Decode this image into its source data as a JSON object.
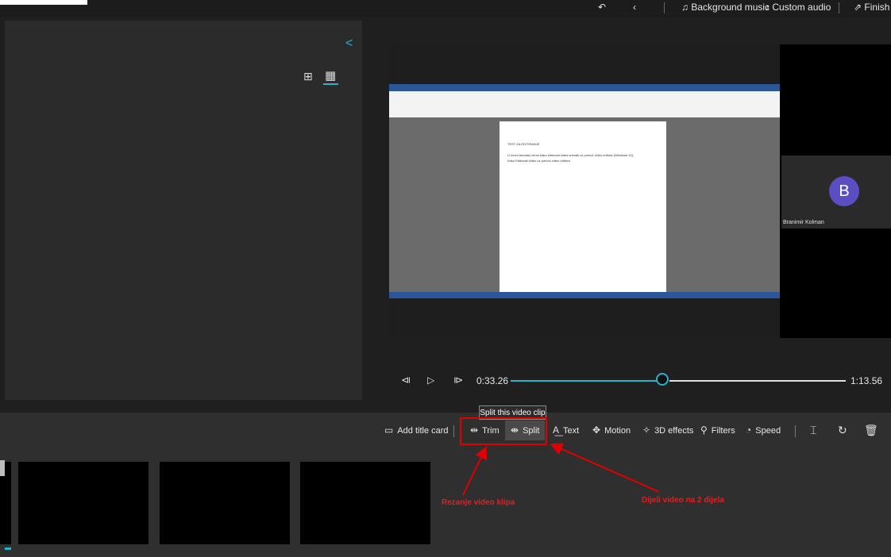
{
  "topbar": {
    "background_music": "Background music",
    "custom_audio": "Custom audio",
    "finish": "Finish v"
  },
  "library": {
    "collapse_icon": "chevron-left-icon",
    "view_options": [
      "grid-large-icon",
      "grid-small-icon"
    ]
  },
  "preview": {
    "doc_lines": [
      "TEST ZA EDITIRANJE",
      "U ovom tutorialu ćemo kako editovati video snimak uz pomoć video editora (Windows 10).",
      "Kako Editovati video uz pomoć video editora"
    ],
    "participant": {
      "initial": "B",
      "name": "Branimir Kolman",
      "color": "#5b4ec2"
    }
  },
  "playback": {
    "current_time": "0:33.26",
    "total_time": "1:13.56",
    "progress": 0.45,
    "accent": "#2bb1c9"
  },
  "toolbar": {
    "add_title_card": "Add title card",
    "trim": "Trim",
    "split": "Split",
    "split_tooltip": "Split this video clip",
    "text": "Text",
    "motion": "Motion",
    "effects_3d": "3D effects",
    "filters": "Filters",
    "speed": "Speed"
  },
  "annotations": {
    "trim_note": "Rezanje video klipa",
    "split_note": "Dijeli video na 2 dijela",
    "color": "#e00000"
  }
}
